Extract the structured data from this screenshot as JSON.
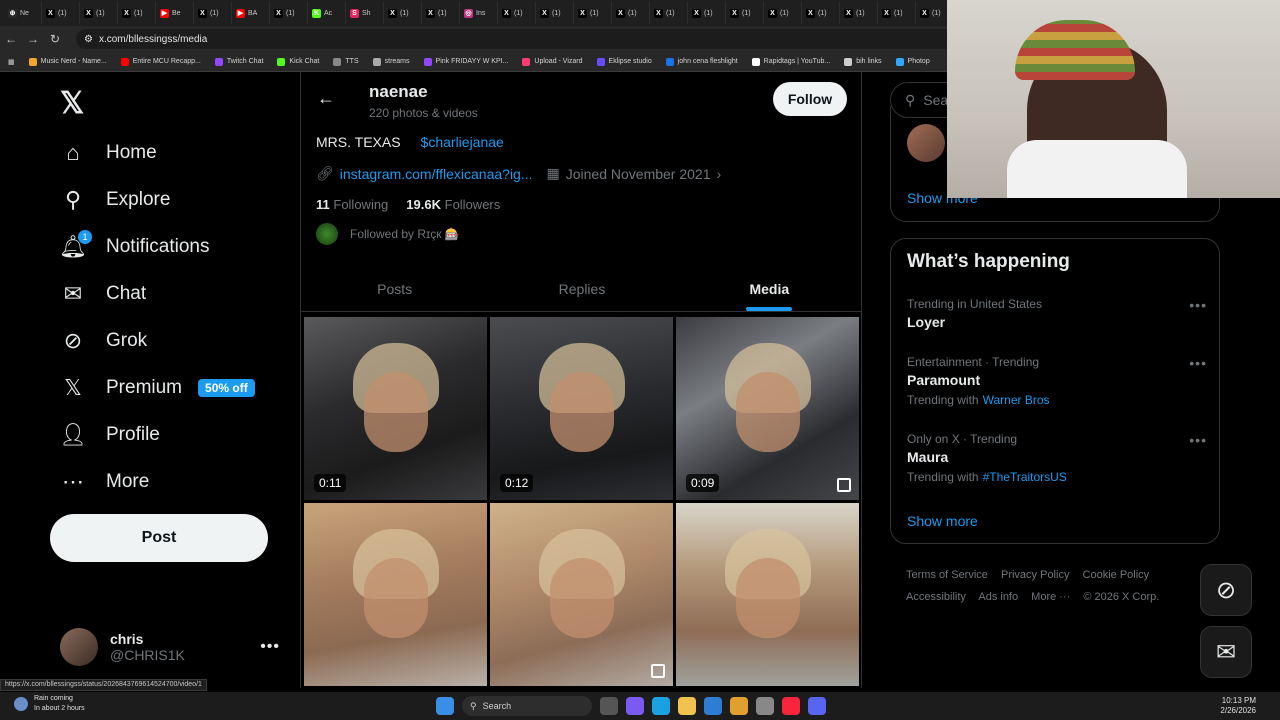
{
  "browser": {
    "tabs": [
      {
        "label": "Ne",
        "color": "#2a2a2a",
        "glyph": "⊕"
      },
      {
        "label": "(1)",
        "color": "#000000",
        "glyph": "X"
      },
      {
        "label": "(1)",
        "color": "#000000",
        "glyph": "X"
      },
      {
        "label": "(1)",
        "color": "#000000",
        "glyph": "X"
      },
      {
        "label": "Be",
        "color": "#ff0000",
        "glyph": "▶"
      },
      {
        "label": "(1)",
        "color": "#000000",
        "glyph": "X"
      },
      {
        "label": "BA",
        "color": "#ff0000",
        "glyph": "▶"
      },
      {
        "label": "(1)",
        "color": "#000000",
        "glyph": "X"
      },
      {
        "label": "Ac",
        "color": "#53fc18",
        "glyph": "K"
      },
      {
        "label": "Sh",
        "color": "#e0245e",
        "glyph": "S"
      },
      {
        "label": "(1)",
        "color": "#000000",
        "glyph": "X"
      },
      {
        "label": "(1)",
        "color": "#000000",
        "glyph": "X"
      },
      {
        "label": "Ins",
        "color": "#c13584",
        "glyph": "◎"
      },
      {
        "label": "(1)",
        "color": "#000000",
        "glyph": "X"
      },
      {
        "label": "(1)",
        "color": "#000000",
        "glyph": "X"
      },
      {
        "label": "(1)",
        "color": "#000000",
        "glyph": "X"
      },
      {
        "label": "(1)",
        "color": "#000000",
        "glyph": "X"
      },
      {
        "label": "(1)",
        "color": "#000000",
        "glyph": "X"
      },
      {
        "label": "(1)",
        "color": "#000000",
        "glyph": "X"
      },
      {
        "label": "(1)",
        "color": "#000000",
        "glyph": "X"
      },
      {
        "label": "(1)",
        "color": "#000000",
        "glyph": "X"
      },
      {
        "label": "(1)",
        "color": "#000000",
        "glyph": "X"
      },
      {
        "label": "(1)",
        "color": "#000000",
        "glyph": "X"
      },
      {
        "label": "(1)",
        "color": "#000000",
        "glyph": "X"
      },
      {
        "label": "(1)",
        "color": "#000000",
        "glyph": "X"
      }
    ],
    "url": "x.com/bllessingss/media",
    "bookmarks": [
      {
        "label": "Music Nerd - Name...",
        "color": "#f4a52a"
      },
      {
        "label": "Entire MCU Recapp...",
        "color": "#ff0000"
      },
      {
        "label": "Twitch Chat",
        "color": "#9146ff"
      },
      {
        "label": "Kick Chat",
        "color": "#53fc18"
      },
      {
        "label": "TTS",
        "color": "#888888"
      },
      {
        "label": "streams",
        "color": "#aaaaaa"
      },
      {
        "label": "Pink FRIDAYY W KPI...",
        "color": "#9146ff"
      },
      {
        "label": "Upload - Vizard",
        "color": "#ff3d71"
      },
      {
        "label": "Eklipse studio",
        "color": "#6a4cff"
      },
      {
        "label": "john cena fleshlight",
        "color": "#1a73e8"
      },
      {
        "label": "Rapidtags | YouTub...",
        "color": "#ffffff"
      },
      {
        "label": "bih links",
        "color": "#cccccc"
      },
      {
        "label": "Photop",
        "color": "#31a8ff"
      }
    ]
  },
  "nav": {
    "home": "Home",
    "explore": "Explore",
    "notifications": "Notifications",
    "notifications_count": "1",
    "chat": "Chat",
    "grok": "Grok",
    "premium": "Premium",
    "premium_badge": "50% off",
    "profile": "Profile",
    "more": "More",
    "post": "Post",
    "account_name": "chris",
    "account_handle": "@CHRIS1K"
  },
  "profile": {
    "name": "naenae",
    "count": "220 photos & videos",
    "follow_label": "Follow",
    "bio_text": "MRS. TEXAS",
    "bio_cashtag": "$charliejanae",
    "link": "instagram.com/fflexicanaa?ig...",
    "joined": "Joined November 2021",
    "following_count": "11",
    "following_label": "Following",
    "followers_count": "19.6K",
    "followers_label": "Followers",
    "followed_by": "Followed by Rɪçк 🎰"
  },
  "tabs": {
    "posts": "Posts",
    "replies": "Replies",
    "media": "Media"
  },
  "media": [
    {
      "duration": "0:11",
      "multi": false
    },
    {
      "duration": "0:12",
      "multi": false
    },
    {
      "duration": "0:09",
      "multi": true
    },
    {
      "duration": "",
      "multi": false
    },
    {
      "duration": "",
      "multi": true
    },
    {
      "duration": "",
      "multi": false
    }
  ],
  "sidebar": {
    "search_placeholder": "Search",
    "show_more_top": "Show more",
    "whats_happening": "What’s happening",
    "trends": [
      {
        "category": "Trending in United States",
        "name": "Loyer",
        "with_label": "",
        "with": ""
      },
      {
        "category": "Entertainment · Trending",
        "name": "Paramount",
        "with_label": "Trending with",
        "with": "Warner Bros"
      },
      {
        "category": "Only on X · Trending",
        "name": "Maura",
        "with_label": "Trending with",
        "with": "#TheTraitorsUS"
      }
    ],
    "show_more": "Show more",
    "footer": {
      "terms": "Terms of Service",
      "privacy": "Privacy Policy",
      "cookie": "Cookie Policy",
      "accessibility": "Accessibility",
      "ads": "Ads info",
      "more": "More ···",
      "copyright": "© 2026 X Corp."
    }
  },
  "status_url": "https://x.com/bllessingss/status/2026843769614524700/video/1",
  "taskbar": {
    "weather_title": "Rain coming",
    "weather_sub": "In about 2 hours",
    "search": "Search",
    "time": "10:13 PM",
    "date": "2/26/2026"
  }
}
